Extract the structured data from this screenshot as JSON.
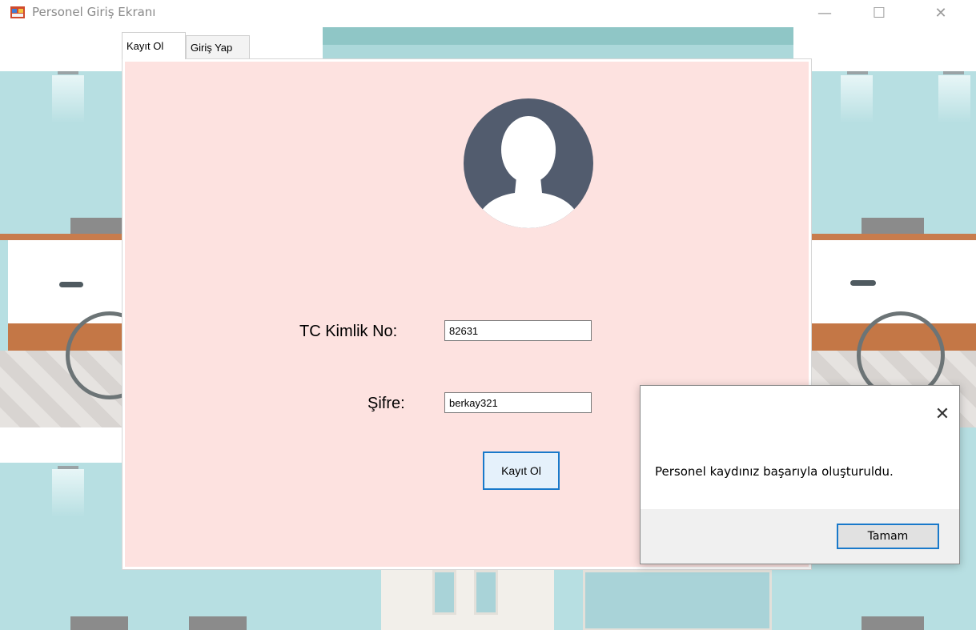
{
  "window": {
    "title": "Personel Giriş Ekranı",
    "app_icon": "winforms-app-icon",
    "controls": {
      "minimize": "—",
      "maximize": "☐",
      "close": "✕"
    }
  },
  "tabs": [
    {
      "label": "Kayıt Ol",
      "active": true
    },
    {
      "label": "Giriş Yap",
      "active": false
    }
  ],
  "form": {
    "avatar_icon": "user-avatar-icon",
    "tc_label": "TC Kimlik No:",
    "tc_value": "82631",
    "password_label": "Şifre:",
    "password_value": "berkay321",
    "submit_label": "Kayıt Ol",
    "panel_color": "#fde2e0"
  },
  "message_box": {
    "close_glyph": "✕",
    "text": "Personel kaydınız başarıyla oluşturuldu.",
    "ok_label": "Tamam"
  },
  "colors": {
    "accent": "#1979ca",
    "wall": "#b7dfe2",
    "avatar": "#525c6e"
  }
}
